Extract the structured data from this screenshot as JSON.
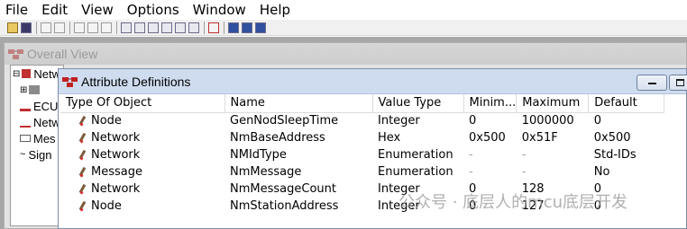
{
  "menu": [
    "File",
    "Edit",
    "View",
    "Options",
    "Window",
    "Help"
  ],
  "toolbar_icons": [
    "open-icon",
    "save-icon",
    "copy-icon",
    "paste-icon",
    "properties-icon",
    "find-icon",
    "delete-icon",
    "text-icon",
    "table-icon",
    "table-icon",
    "table-icon",
    "table-icon",
    "table-icon",
    "abc-icon",
    "list-icon",
    "split-horizontal-icon",
    "split-vertical-icon"
  ],
  "overall_view": {
    "title": "Overall View",
    "tree": [
      "Netw",
      "",
      "ECU",
      "Netw",
      "Mes",
      "Sign"
    ]
  },
  "attribute_definitions": {
    "title": "Attribute Definitions",
    "columns": [
      "Type Of Object",
      "Name",
      "Value Type",
      "Minim...",
      "Maximum",
      "Default"
    ],
    "rows": [
      {
        "type": "Node",
        "name": "GenNodSleepTime",
        "value_type": "Integer",
        "min": "0",
        "max": "1000000",
        "default": "0"
      },
      {
        "type": "Network",
        "name": "NmBaseAddress",
        "value_type": "Hex",
        "min": "0x500",
        "max": "0x51F",
        "default": "0x500"
      },
      {
        "type": "Network",
        "name": "NMIdType",
        "value_type": "Enumeration",
        "min": "-",
        "max": "-",
        "default": "Std-IDs"
      },
      {
        "type": "Message",
        "name": "NmMessage",
        "value_type": "Enumeration",
        "min": "-",
        "max": "-",
        "default": "No"
      },
      {
        "type": "Network",
        "name": "NmMessageCount",
        "value_type": "Integer",
        "min": "0",
        "max": "128",
        "default": "0"
      },
      {
        "type": "Node",
        "name": "NmStationAddress",
        "value_type": "Integer",
        "min": "0",
        "max": "127",
        "default": "0"
      }
    ]
  },
  "watermark": "公众号 · 底层人的mcu底层开发"
}
